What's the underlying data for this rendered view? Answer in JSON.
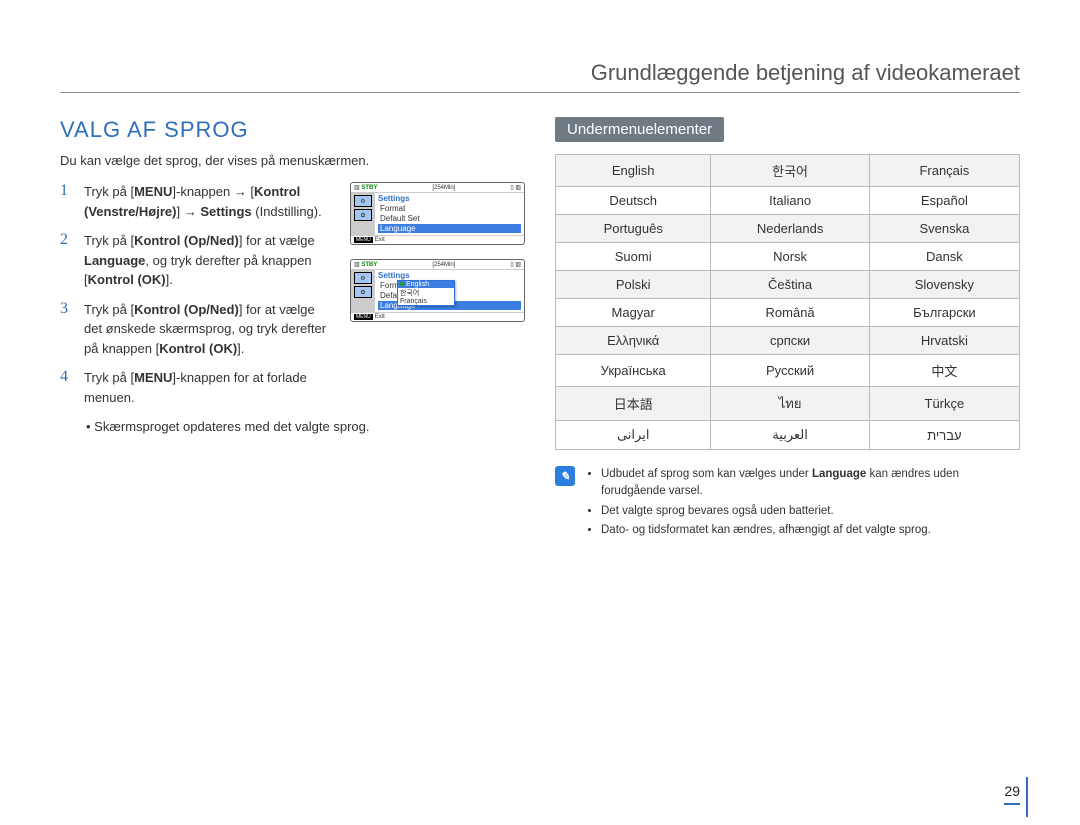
{
  "header": {
    "breadcrumb": "Grundlæggende betjening af videokameraet"
  },
  "left": {
    "title": "VALG AF SPROG",
    "intro": "Du kan vælge det sprog, der vises på menuskærmen.",
    "steps": [
      {
        "n": "1",
        "parts": [
          "Tryk på [",
          "MENU",
          "]-knappen ",
          "→",
          " [",
          "Kontrol (Venstre/Højre)",
          "] ",
          "→",
          " ",
          "Settings",
          " (Indstilling)."
        ]
      },
      {
        "n": "2",
        "parts": [
          "Tryk på [",
          "Kontrol (Op/Ned)",
          "] for at vælge ",
          "Language",
          ", og tryk derefter på knappen [",
          "Kontrol (OK)",
          "]."
        ]
      },
      {
        "n": "3",
        "parts": [
          "Tryk på [",
          "Kontrol (Op/Ned)",
          "] for at vælge det ønskede skærmsprog, og tryk derefter på knappen [",
          "Kontrol (OK)",
          "]."
        ]
      },
      {
        "n": "4",
        "parts": [
          "Tryk på [",
          "MENU",
          "]-knappen for at forlade menuen."
        ]
      }
    ],
    "bullet": "Skærmsproget opdateres med det valgte sprog."
  },
  "screenshots": {
    "stby": "STBY",
    "time": "[254Min]",
    "menu_title": "Settings",
    "items": [
      "Format",
      "Default Set",
      "Language"
    ],
    "exit_btn": "MENU",
    "exit_label": "Exit",
    "popout": [
      "English",
      "한국어",
      "Français"
    ]
  },
  "right": {
    "subheader": "Undermenuelementer",
    "langs": [
      [
        "English",
        "한국어",
        "Français"
      ],
      [
        "Deutsch",
        "Italiano",
        "Español"
      ],
      [
        "Português",
        "Nederlands",
        "Svenska"
      ],
      [
        "Suomi",
        "Norsk",
        "Dansk"
      ],
      [
        "Polski",
        "Čeština",
        "Slovensky"
      ],
      [
        "Magyar",
        "Română",
        "Български"
      ],
      [
        "Ελληνικά",
        "српски",
        "Hrvatski"
      ],
      [
        "Українська",
        "Русский",
        "中文"
      ],
      [
        "日本語",
        "ไทย",
        "Türkçe"
      ],
      [
        "ایرانی",
        "العربیة",
        "עברית"
      ]
    ],
    "notes": [
      "Udbudet af sprog som kan vælges under Language kan ændres uden forudgående varsel.",
      "Det valgte sprog bevares også uden batteriet.",
      "Dato- og tidsformatet kan ændres, afhængigt af det valgte sprog."
    ],
    "note_bold_word": "Language"
  },
  "page_number": "29"
}
